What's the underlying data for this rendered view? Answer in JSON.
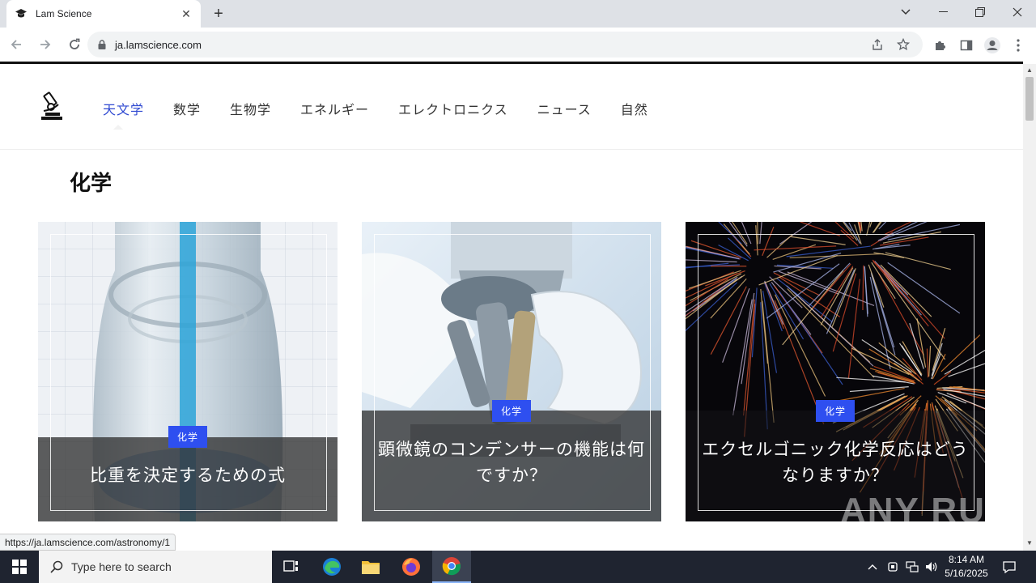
{
  "browser": {
    "tab_title": "Lam Science",
    "url": "ja.lamscience.com",
    "status_url": "https://ja.lamscience.com/astronomy/1"
  },
  "site": {
    "nav": [
      "天文学",
      "数学",
      "生物学",
      "エネルギー",
      "エレクトロニクス",
      "ニュース",
      "自然"
    ],
    "active_nav_index": 0,
    "section_title": "化学",
    "cards": [
      {
        "badge": "化学",
        "title": "比重を決定するための式",
        "image": "test-tube-blue-liquid"
      },
      {
        "badge": "化学",
        "title": "顕微鏡のコンデンサーの機能は何ですか？",
        "image": "microscope-gloved-hand"
      },
      {
        "badge": "化学",
        "title": "エクセルゴニック化学反応はどうなりますか？",
        "image": "fireworks-night"
      }
    ],
    "accent_color": "#2e4ff0",
    "watermark": "ANY RUN"
  },
  "taskbar": {
    "search_placeholder": "Type here to search",
    "time": "8:14 AM",
    "date": "5/16/2025"
  }
}
